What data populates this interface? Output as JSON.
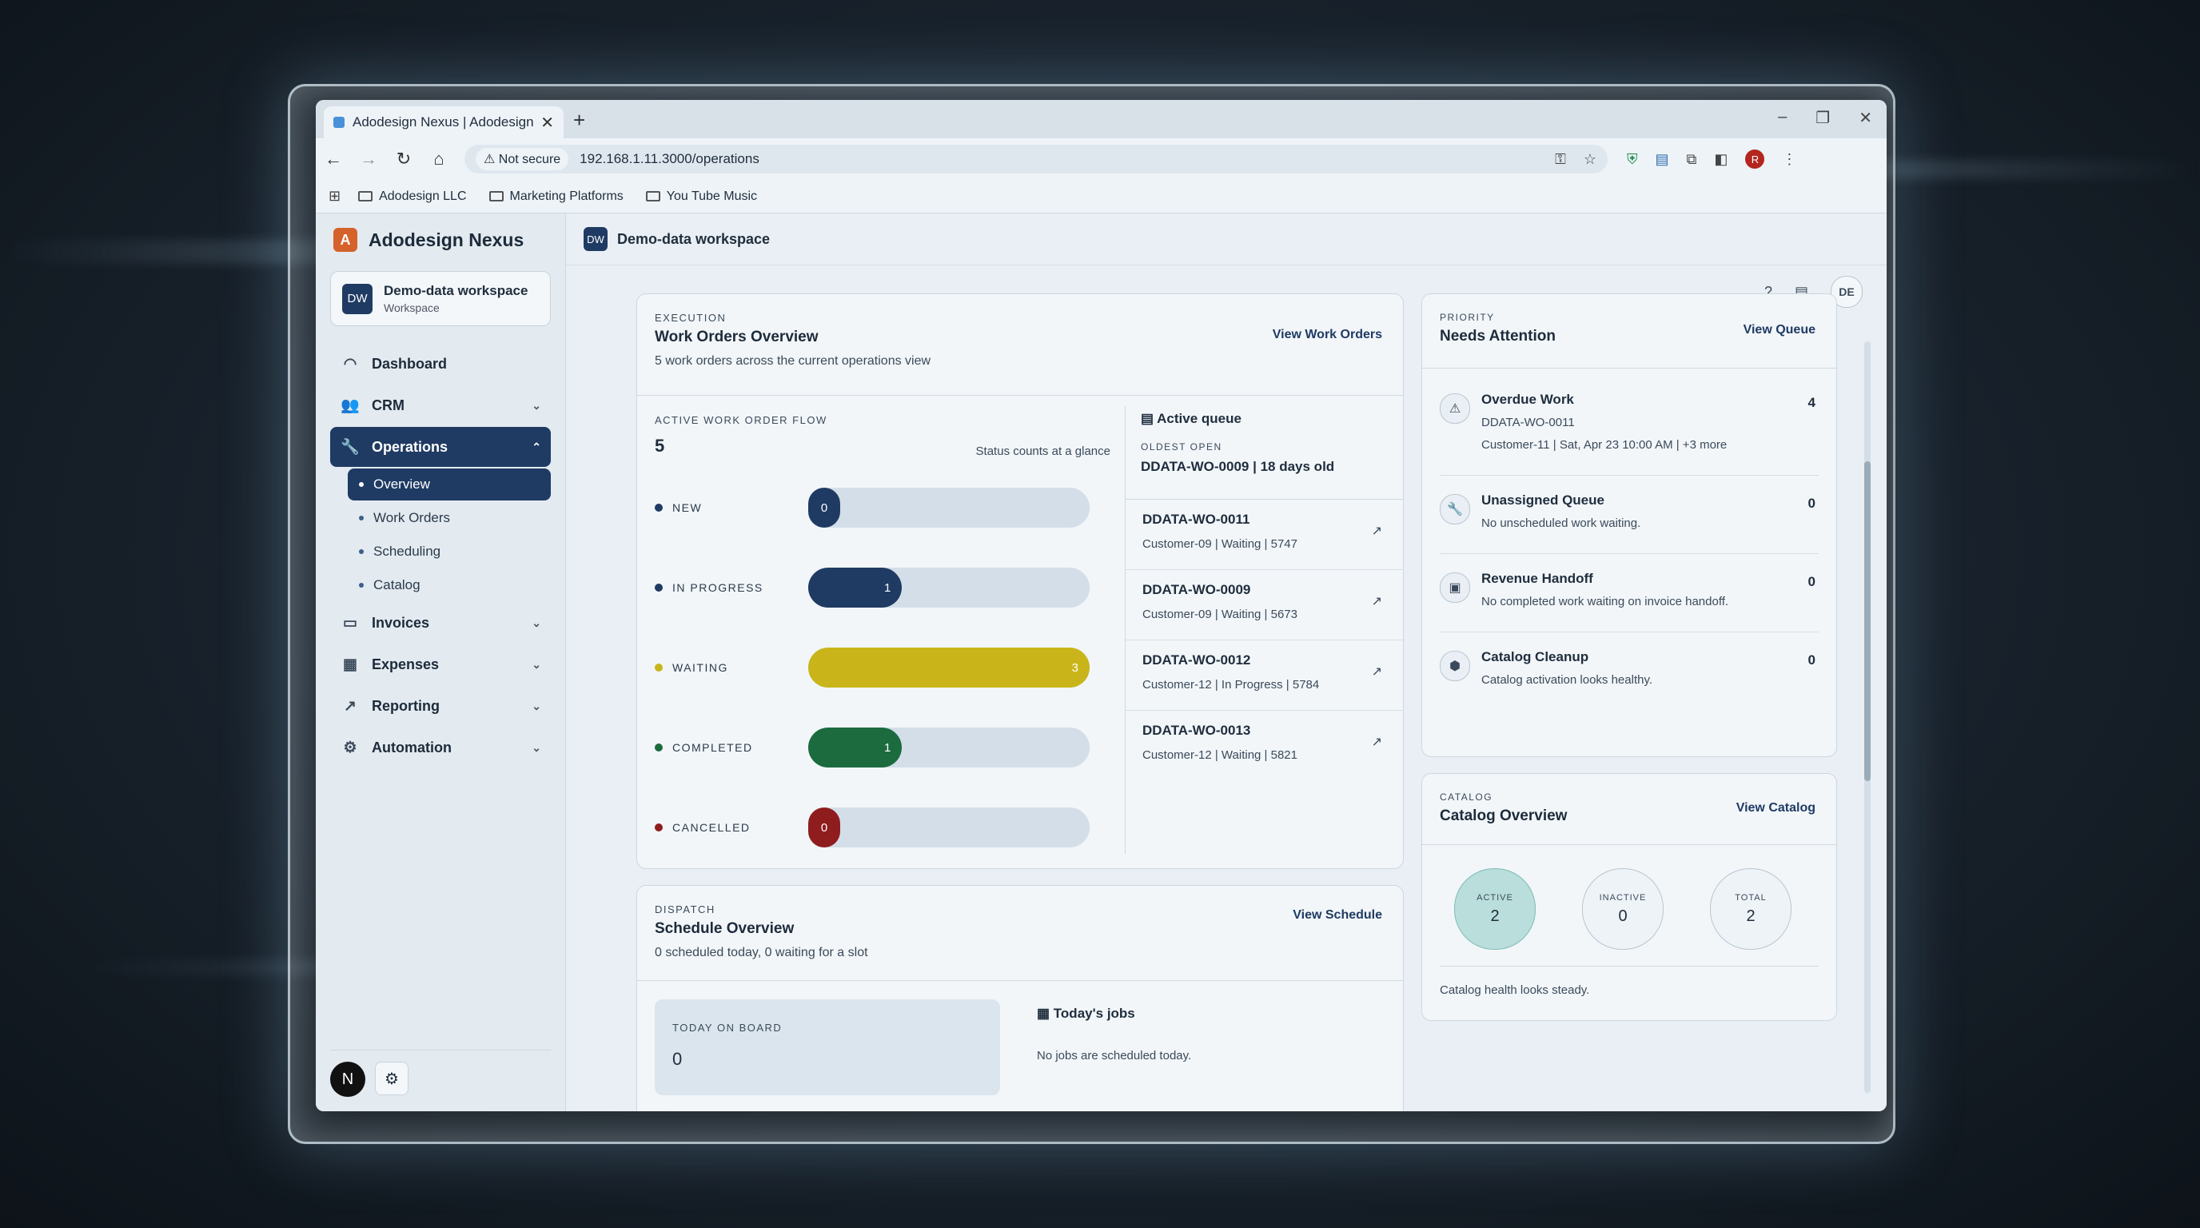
{
  "browser": {
    "tab_title": "Adodesign Nexus | Adodesign",
    "not_secure": "Not secure",
    "url": "192.168.1.11.3000/operations",
    "bookmarks": [
      "Adodesign LLC",
      "Marketing Platforms",
      "You Tube Music"
    ],
    "profile_initial": "R"
  },
  "sidebar": {
    "brand": "Adodesign Nexus",
    "workspace": {
      "badge": "DW",
      "name": "Demo-data workspace",
      "sub": "Workspace"
    },
    "items": [
      {
        "label": "Dashboard"
      },
      {
        "label": "CRM"
      },
      {
        "label": "Operations"
      },
      {
        "label": "Invoices"
      },
      {
        "label": "Expenses"
      },
      {
        "label": "Reporting"
      },
      {
        "label": "Automation"
      }
    ],
    "operations_sub": [
      "Overview",
      "Work Orders",
      "Scheduling",
      "Catalog"
    ],
    "user_initial": "N"
  },
  "header": {
    "badge": "DW",
    "title": "Demo-data workspace",
    "user": "DE"
  },
  "work_orders": {
    "eyebrow": "EXECUTION",
    "title": "Work Orders Overview",
    "subtitle": "5 work orders across the current operations view",
    "link": "View Work Orders",
    "flow_label": "ACTIVE WORK ORDER FLOW",
    "flow_total": "5",
    "flow_note": "Status counts at a glance",
    "flow": [
      {
        "label": "NEW",
        "count": "0",
        "value": 0,
        "color": "#1f3b63",
        "dot": "#1f3b63"
      },
      {
        "label": "IN PROGRESS",
        "count": "1",
        "value": 1,
        "color": "#1f3b63",
        "dot": "#1f3b63"
      },
      {
        "label": "WAITING",
        "count": "3",
        "value": 3,
        "color": "#c9b51a",
        "dot": "#c9b51a"
      },
      {
        "label": "COMPLETED",
        "count": "1",
        "value": 1,
        "color": "#1c6b3f",
        "dot": "#1c6b3f"
      },
      {
        "label": "CANCELLED",
        "count": "0",
        "value": 0,
        "color": "#8f1d1d",
        "dot": "#8f1d1d"
      }
    ],
    "queue_title": "Active queue",
    "oldest_label": "OLDEST OPEN",
    "oldest_value": "DDATA-WO-0009 | 18 days old",
    "queue": [
      {
        "id": "DDATA-WO-0011",
        "meta": "Customer-09 | Waiting | 5747"
      },
      {
        "id": "DDATA-WO-0009",
        "meta": "Customer-09 | Waiting | 5673"
      },
      {
        "id": "DDATA-WO-0012",
        "meta": "Customer-12 | In Progress | 5784"
      },
      {
        "id": "DDATA-WO-0013",
        "meta": "Customer-12 | Waiting | 5821"
      }
    ]
  },
  "attention": {
    "eyebrow": "PRIORITY",
    "title": "Needs Attention",
    "link": "View Queue",
    "items": [
      {
        "title": "Overdue Work",
        "line1": "DDATA-WO-0011",
        "line2": "Customer-11 | Sat, Apr 23 10:00 AM | +3 more",
        "count": "4"
      },
      {
        "title": "Unassigned Queue",
        "line1": "No unscheduled work waiting.",
        "line2": "",
        "count": "0"
      },
      {
        "title": "Revenue Handoff",
        "line1": "No completed work waiting on invoice handoff.",
        "line2": "",
        "count": "0"
      },
      {
        "title": "Catalog Cleanup",
        "line1": "Catalog activation looks healthy.",
        "line2": "",
        "count": "0"
      }
    ]
  },
  "catalog": {
    "eyebrow": "CATALOG",
    "title": "Catalog Overview",
    "link": "View Catalog",
    "stats": [
      {
        "label": "ACTIVE",
        "value": "2"
      },
      {
        "label": "INACTIVE",
        "value": "0"
      },
      {
        "label": "TOTAL",
        "value": "2"
      }
    ],
    "health": "Catalog health looks steady."
  },
  "schedule": {
    "eyebrow": "DISPATCH",
    "title": "Schedule Overview",
    "subtitle": "0 scheduled today, 0 waiting for a slot",
    "link": "View Schedule",
    "board_label": "TODAY ON BOARD",
    "board_value": "0",
    "jobs_title": "Today's jobs",
    "jobs_empty": "No jobs are scheduled today."
  }
}
